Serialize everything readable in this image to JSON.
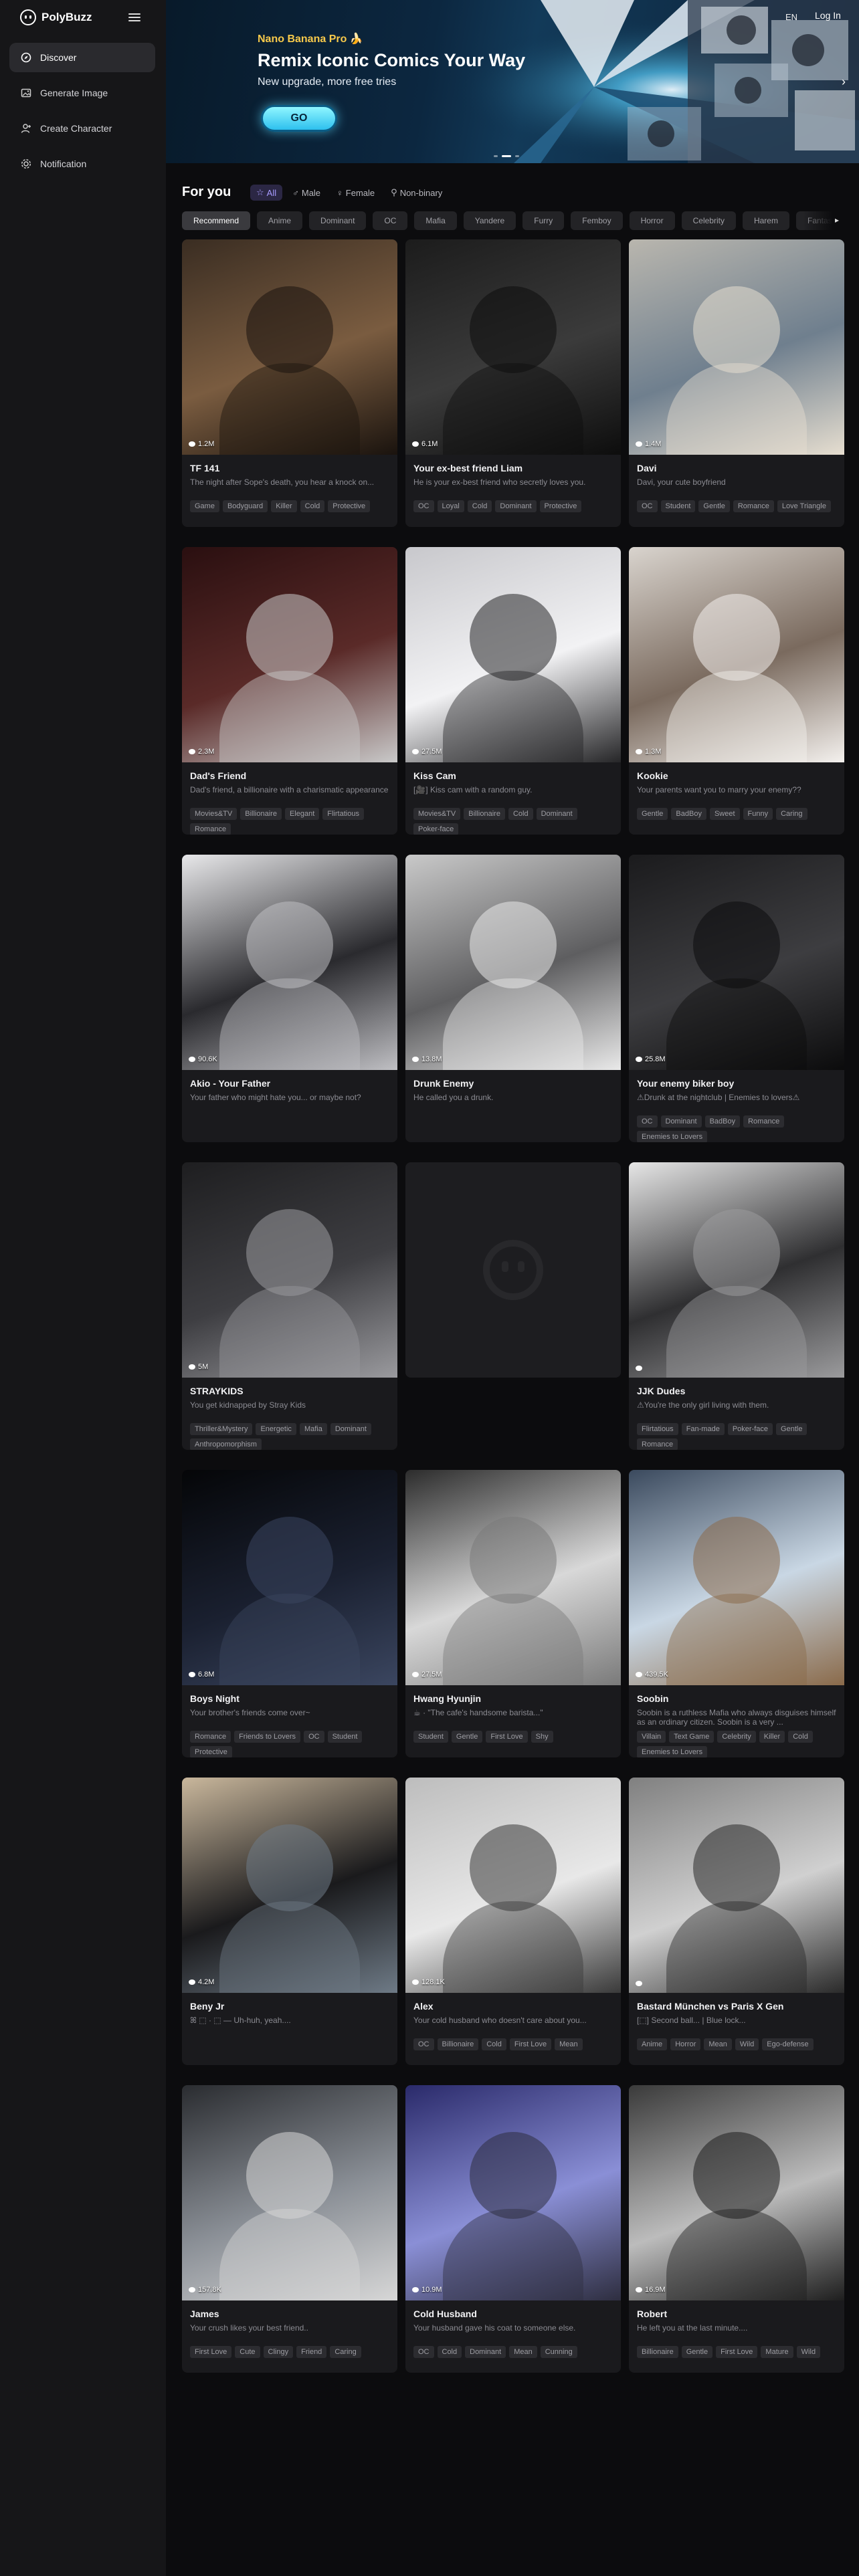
{
  "brand": {
    "name": "PolyBuzz"
  },
  "sidebar": {
    "items": [
      {
        "label": "Discover",
        "icon": "compass-icon"
      },
      {
        "label": "Generate Image",
        "icon": "image-icon"
      },
      {
        "label": "Create Character",
        "icon": "character-icon"
      },
      {
        "label": "Notification",
        "icon": "bell-gear-icon"
      }
    ]
  },
  "banner": {
    "tag": "Nano Banana Pro 🍌",
    "title": "Remix Iconic Comics Your Way",
    "subtitle": "New upgrade, more free tries",
    "cta": "GO"
  },
  "header": {
    "lang": "EN",
    "login": "Log In"
  },
  "feed": {
    "title": "For you",
    "gender_filters": [
      "All",
      "Male",
      "Female",
      "Non-binary"
    ],
    "tags": [
      "Recommend",
      "Anime",
      "Dominant",
      "OC",
      "Mafia",
      "Yandere",
      "Furry",
      "Femboy",
      "Horror",
      "Celebrity",
      "Harem",
      "Fantasy"
    ]
  },
  "cards": [
    {
      "views": "1.2M",
      "title": "TF 141",
      "desc": "The night after Sope's death, you hear a knock on...",
      "tags": [
        "Game",
        "Bodyguard",
        "Killer",
        "Cold",
        "Protective"
      ]
    },
    {
      "views": "6.1M",
      "title": "Your ex-best friend Liam",
      "desc": "He is your ex-best friend who secretly loves you.",
      "tags": [
        "OC",
        "Loyal",
        "Cold",
        "Dominant",
        "Protective"
      ]
    },
    {
      "views": "1.4M",
      "title": "Davi",
      "desc": "Davi, your cute boyfriend",
      "tags": [
        "OC",
        "Student",
        "Gentle",
        "Romance",
        "Love Triangle"
      ]
    },
    {
      "views": "2.3M",
      "title": "Dad's Friend",
      "desc": "Dad's friend, a billionaire with a charismatic appearance",
      "tags": [
        "Movies&TV",
        "Billionaire",
        "Elegant",
        "Flirtatious",
        "Romance"
      ]
    },
    {
      "views": "27.5M",
      "title": "Kiss Cam",
      "desc": "[🎥] Kiss cam with a random guy.",
      "tags": [
        "Movies&TV",
        "Billionaire",
        "Cold",
        "Dominant",
        "Poker-face"
      ]
    },
    {
      "views": "1.3M",
      "title": "Kookie",
      "desc": "Your parents want you to marry your enemy??",
      "tags": [
        "Gentle",
        "BadBoy",
        "Sweet",
        "Funny",
        "Caring"
      ]
    },
    {
      "views": "90.6K",
      "title": "Akio - Your Father",
      "desc": "Your father who might hate you... or maybe not?",
      "tags": []
    },
    {
      "views": "13.8M",
      "title": "Drunk Enemy",
      "desc": "He called you a drunk.",
      "tags": []
    },
    {
      "views": "25.8M",
      "title": "Your enemy biker boy",
      "desc": "⚠Drunk at the nightclub | Enemies to lovers⚠",
      "tags": [
        "OC",
        "Dominant",
        "BadBoy",
        "Romance",
        "Enemies to Lovers"
      ]
    },
    {
      "views": "5M",
      "title": "STRAYKIDS",
      "desc": "You get kidnapped by Stray Kids",
      "tags": [
        "Thriller&Mystery",
        "Energetic",
        "Mafia",
        "Dominant",
        "Anthropomorphism"
      ]
    },
    {
      "views": "",
      "title": "",
      "desc": "",
      "tags": []
    },
    {
      "views": "",
      "title": "JJK Dudes",
      "desc": "⚠You're the only girl living with them.",
      "tags": [
        "Flirtatious",
        "Fan-made",
        "Poker-face",
        "Gentle",
        "Romance"
      ]
    },
    {
      "views": "6.8M",
      "title": "Boys Night",
      "desc": "Your brother's friends come over~",
      "tags": [
        "Romance",
        "Friends to Lovers",
        "OC",
        "Student",
        "Protective"
      ]
    },
    {
      "views": "27.5M",
      "title": "Hwang Hyunjin",
      "desc": "☕ · \"The cafe's handsome barista...\"",
      "tags": [
        "Student",
        "Gentle",
        "First Love",
        "Shy"
      ]
    },
    {
      "views": "439.5K",
      "title": "Soobin",
      "desc": "Soobin is a ruthless Mafia who always disguises himself as an ordinary citizen. Soobin is a very ...",
      "tags": [
        "Villain",
        "Text Game",
        "Celebrity",
        "Killer",
        "Cold",
        "Enemies to Lovers"
      ]
    },
    {
      "views": "4.2M",
      "title": "Beny Jr",
      "desc": "ꕤ ⬚ · ⬚ — Uh-huh, yeah....",
      "tags": []
    },
    {
      "views": "128.1K",
      "title": "Alex",
      "desc": "Your cold husband who doesn't care about you...",
      "tags": [
        "OC",
        "Billionaire",
        "Cold",
        "First Love",
        "Mean"
      ]
    },
    {
      "views": "",
      "title": "Bastard München vs Paris X Gen",
      "desc": "[⬚] Second ball... | Blue lock...",
      "tags": [
        "Anime",
        "Horror",
        "Mean",
        "Wild",
        "Ego-defense"
      ]
    },
    {
      "views": "157.8K",
      "title": "James",
      "desc": "Your crush likes your best friend..",
      "tags": [
        "First Love",
        "Cute",
        "Clingy",
        "Friend",
        "Caring"
      ]
    },
    {
      "views": "10.9M",
      "title": "Cold Husband",
      "desc": "Your husband gave his coat to someone else.",
      "tags": [
        "OC",
        "Cold",
        "Dominant",
        "Mean",
        "Cunning"
      ]
    },
    {
      "views": "16.9M",
      "title": "Robert",
      "desc": "He left you at the last minute....",
      "tags": [
        "Billionaire",
        "Gentle",
        "First Love",
        "Mature",
        "Wild"
      ]
    }
  ],
  "colors": {
    "accent": "#a89bff",
    "banner_gold": "#f7c94b",
    "go_button": "#2ec0ee"
  }
}
